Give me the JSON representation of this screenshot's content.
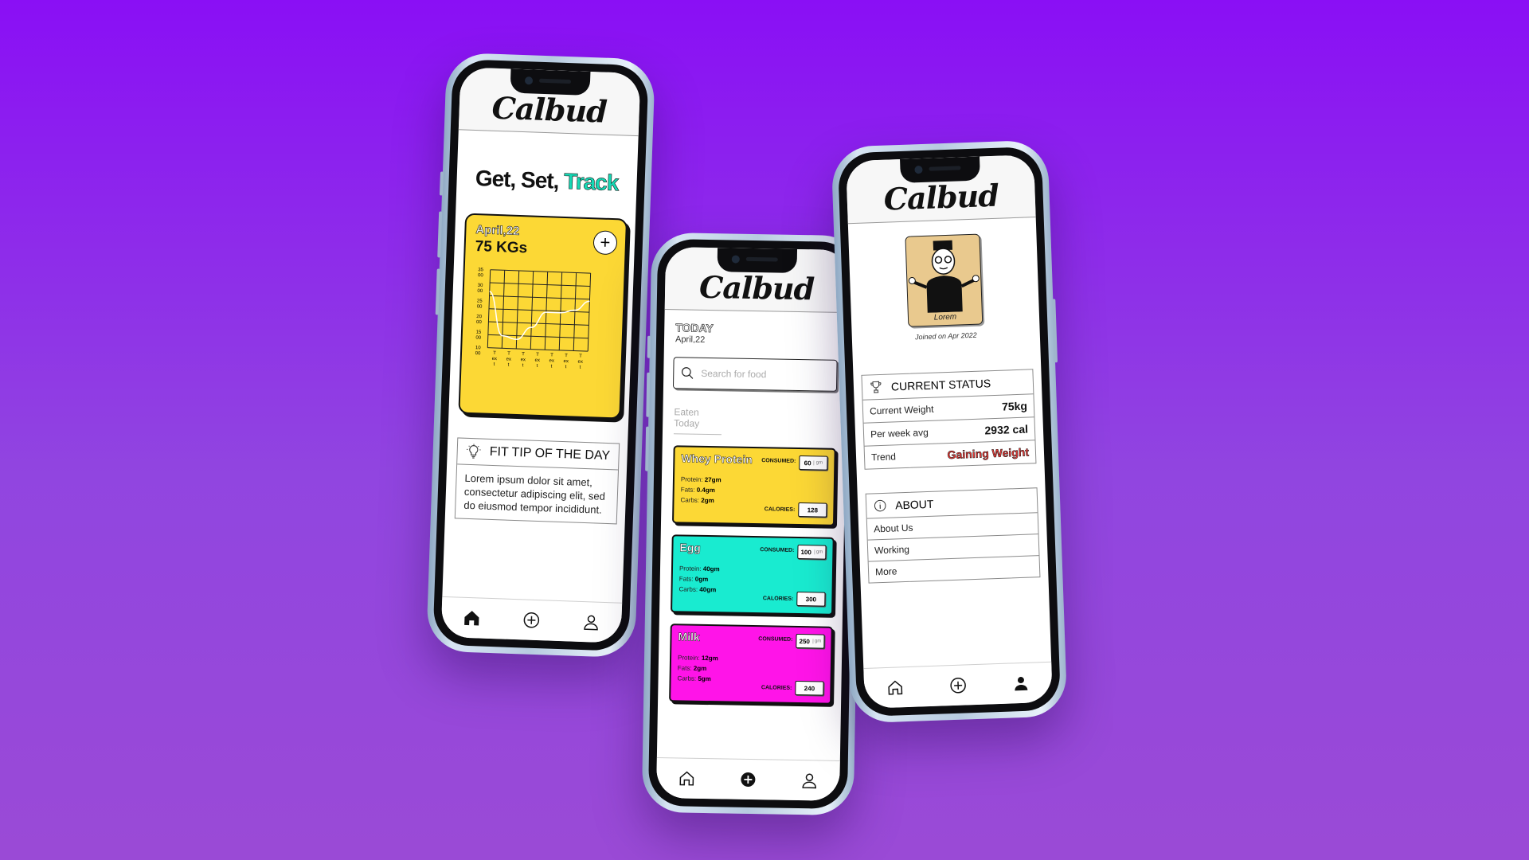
{
  "app": {
    "logo": "Calbud"
  },
  "home": {
    "hero_prefix": "Get, Set, ",
    "hero_accent": "Track",
    "weight_card": {
      "date": "April,22",
      "weight": "75 KGs",
      "add_label": "+",
      "y_ticks": [
        "35",
        "30",
        "25",
        "20",
        "15",
        "10"
      ],
      "y_tick_suffix": "00",
      "x_ticks": [
        "T",
        "T",
        "T",
        "T",
        "T",
        "T",
        "T"
      ],
      "x_tick_sub": [
        "ex",
        "ex",
        "ex",
        "ex",
        "ex",
        "ex",
        "ex"
      ],
      "x_tick_sub2": [
        "t",
        "t",
        "t",
        "t",
        "t",
        "t",
        "t"
      ]
    },
    "tip": {
      "title": "FIT TIP OF THE DAY",
      "body": "Lorem ipsum dolor sit amet, consectetur adipiscing elit, sed do eiusmod tempor incididunt."
    }
  },
  "food_screen": {
    "today_title": "TODAY",
    "today_date": "April,22",
    "search_placeholder": "Search for food",
    "eaten_label": "Eaten Today",
    "consumed_label": "CONSUMED:",
    "calories_label": "CALORIES:",
    "unit": "gm",
    "items": [
      {
        "name": "Whey Protein",
        "protein": "27gm",
        "fats": "0.4gm",
        "carbs": "2gm",
        "consumed": "60",
        "calories": "128",
        "color": "#fcd835"
      },
      {
        "name": "Egg",
        "protein": "40gm",
        "fats": "0gm",
        "carbs": "40gm",
        "consumed": "100",
        "calories": "300",
        "color": "#19ebd0"
      },
      {
        "name": "Milk",
        "protein": "12gm",
        "fats": "2gm",
        "carbs": "5gm",
        "consumed": "250",
        "calories": "240",
        "color": "#ff14e8"
      }
    ],
    "macro_labels": {
      "protein": "Protein:",
      "fats": "Fats:",
      "carbs": "Carbs:"
    }
  },
  "profile": {
    "avatar_name": "Lorem",
    "joined": "Joined on Apr 2022",
    "status_title": "CURRENT STATUS",
    "status_rows": [
      {
        "label": "Current Weight",
        "value": "75kg"
      },
      {
        "label": "Per week avg",
        "value": "2932 cal"
      },
      {
        "label": "Trend",
        "value": "Gaining Weight"
      }
    ],
    "about_title": "ABOUT",
    "about_rows": [
      "About Us",
      "Working",
      "More"
    ]
  },
  "colors": {
    "background": "#8a0ff5",
    "accent_teal": "#16d9b5",
    "yellow": "#fcd835",
    "trend_red": "#e53935"
  },
  "weight_trend_chart": {
    "type": "line",
    "series": [
      {
        "values": [
          28,
          14,
          13,
          17,
          22,
          22,
          23,
          26
        ]
      }
    ],
    "ylim": [
      10,
      35
    ]
  }
}
